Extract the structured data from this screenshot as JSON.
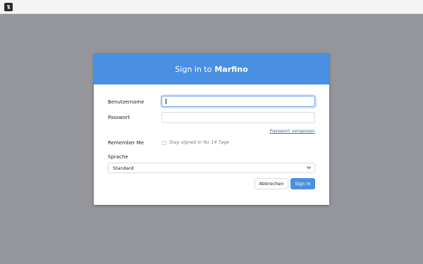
{
  "app": {
    "logo_icon": "app-logo-icon"
  },
  "dialog": {
    "title_prefix": "Sign in to",
    "title_app": "Marfino",
    "header_color": "#4a90e2"
  },
  "form": {
    "username_label": "Benutzername",
    "username_value": "",
    "password_label": "Passwort",
    "password_value": "",
    "forgot_link": "Passwort vergessen",
    "remember_label": "Remember Me",
    "remember_hint": "Stay signed in for 14 Tage",
    "remember_checked": false,
    "language_label": "Sprache",
    "language_value": "Standard",
    "cancel_label": "Abbrechen",
    "signin_label": "Sign In"
  }
}
